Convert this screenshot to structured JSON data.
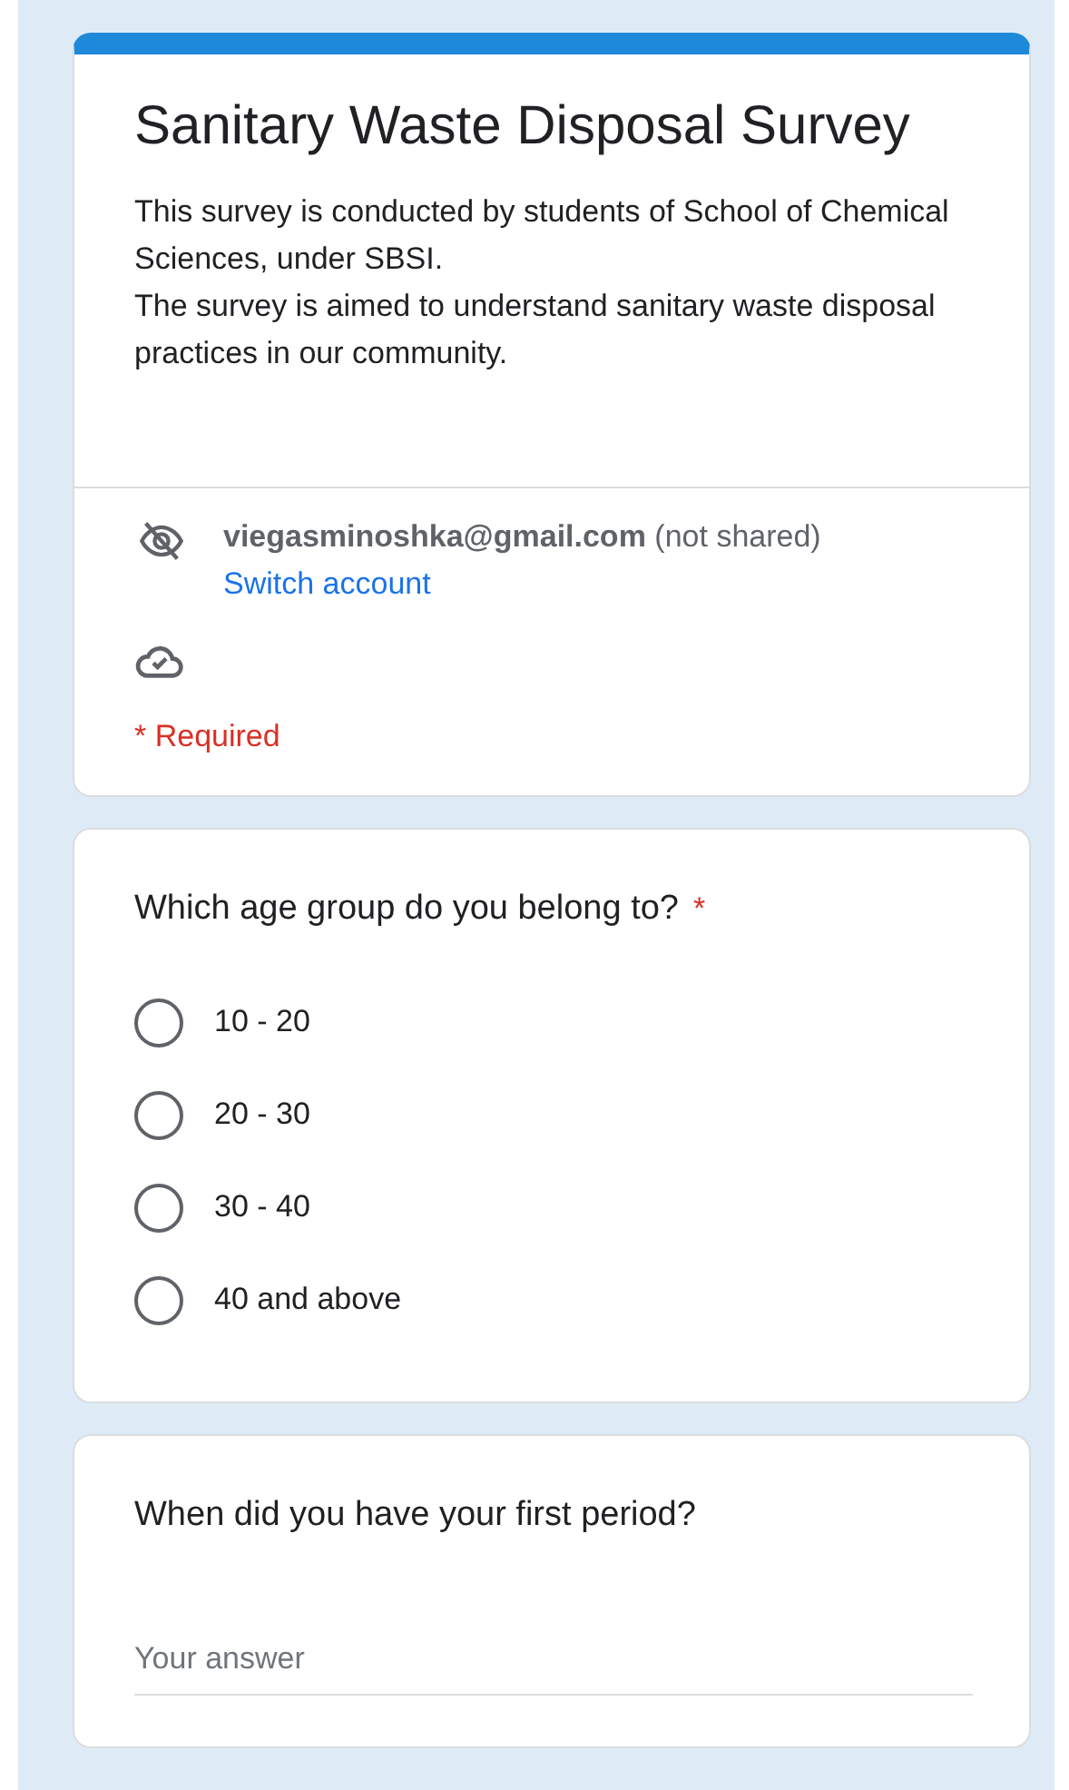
{
  "form": {
    "title": "Sanitary Waste Disposal Survey",
    "description": [
      "This survey is conducted by students of School of Chemical Sciences, under SBSI.",
      "The survey is aimed to understand sanitary waste disposal practices in our community."
    ],
    "account": {
      "email": "viegasminoshka@gmail.com",
      "note": "(not shared)",
      "switch_link": "Switch account"
    },
    "required_note": "* Required"
  },
  "questions": [
    {
      "kind": "radio",
      "title": "Which age group do you belong to?",
      "required_mark": "*",
      "options": [
        {
          "label": "10 - 20",
          "selected": false
        },
        {
          "label": "20 - 30",
          "selected": false
        },
        {
          "label": "30 - 40",
          "selected": false
        },
        {
          "label": "40 and above",
          "selected": false
        }
      ]
    },
    {
      "kind": "text",
      "title": "When did you have your first period?",
      "placeholder": "Your answer"
    }
  ]
}
